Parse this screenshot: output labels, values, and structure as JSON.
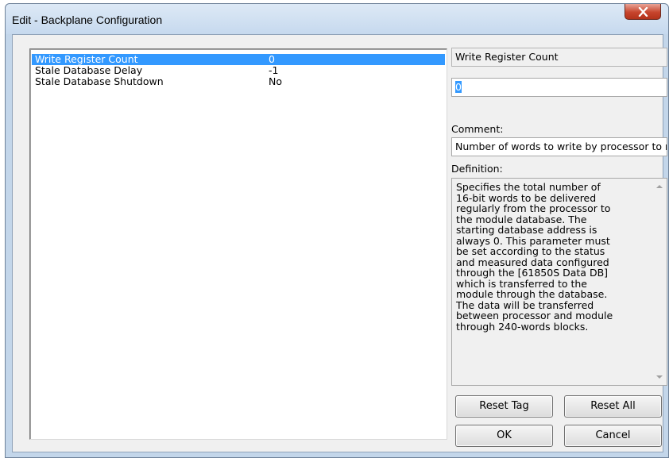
{
  "window": {
    "title": "Edit - Backplane Configuration",
    "close_glyph": "x"
  },
  "list": {
    "rows": [
      {
        "name": "Write Register Count",
        "value": "0",
        "selected": true
      },
      {
        "name": "Stale Database Delay",
        "value": "-1",
        "selected": false
      },
      {
        "name": "Stale Database Shutdown",
        "value": "No",
        "selected": false
      }
    ]
  },
  "editor": {
    "param_name": "Write Register Count",
    "value": "0",
    "comment_label": "Comment:",
    "comment": "Number of words to write by processor to module",
    "definition_label": "Definition:",
    "definition": "Specifies the total number of\n16-bit words to be delivered\nregularly from the processor to\nthe module database. The\nstarting database address is\nalways 0. This parameter must\nbe set according to the status\nand measured data configured\nthrough the [61850S Data DB]\nwhich is transferred to the\nmodule through the database.\nThe data will be transferred\nbetween processor and module\nthrough 240-words blocks."
  },
  "buttons": {
    "reset_tag": "Reset Tag",
    "reset_all": "Reset All",
    "ok": "OK",
    "cancel": "Cancel"
  },
  "colors": {
    "selection": "#3399ff",
    "close_button": "#c7452d",
    "dialog_background": "#f0f0f0"
  }
}
